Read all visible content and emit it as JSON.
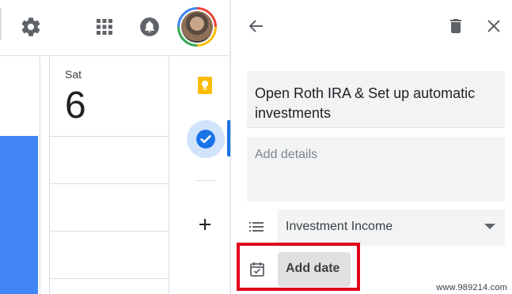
{
  "toolbar": {
    "icons": [
      "gear-icon",
      "apps-grid-icon",
      "bell-icon",
      "avatar"
    ]
  },
  "calendar": {
    "day_name": "Sat",
    "day_number": "6",
    "event_color": "#4285f4"
  },
  "side_strip": {
    "icons": [
      "keep-icon",
      "tasks-icon",
      "plus-icon"
    ],
    "active_color": "#1a73e8"
  },
  "task_panel": {
    "title": "Open Roth IRA & Set up automatic investments",
    "details_placeholder": "Add details",
    "list_name": "Investment Income",
    "add_date_label": "Add date"
  },
  "annotation": {
    "highlight_color": "#e1001a"
  },
  "watermark": "www.989214.com"
}
